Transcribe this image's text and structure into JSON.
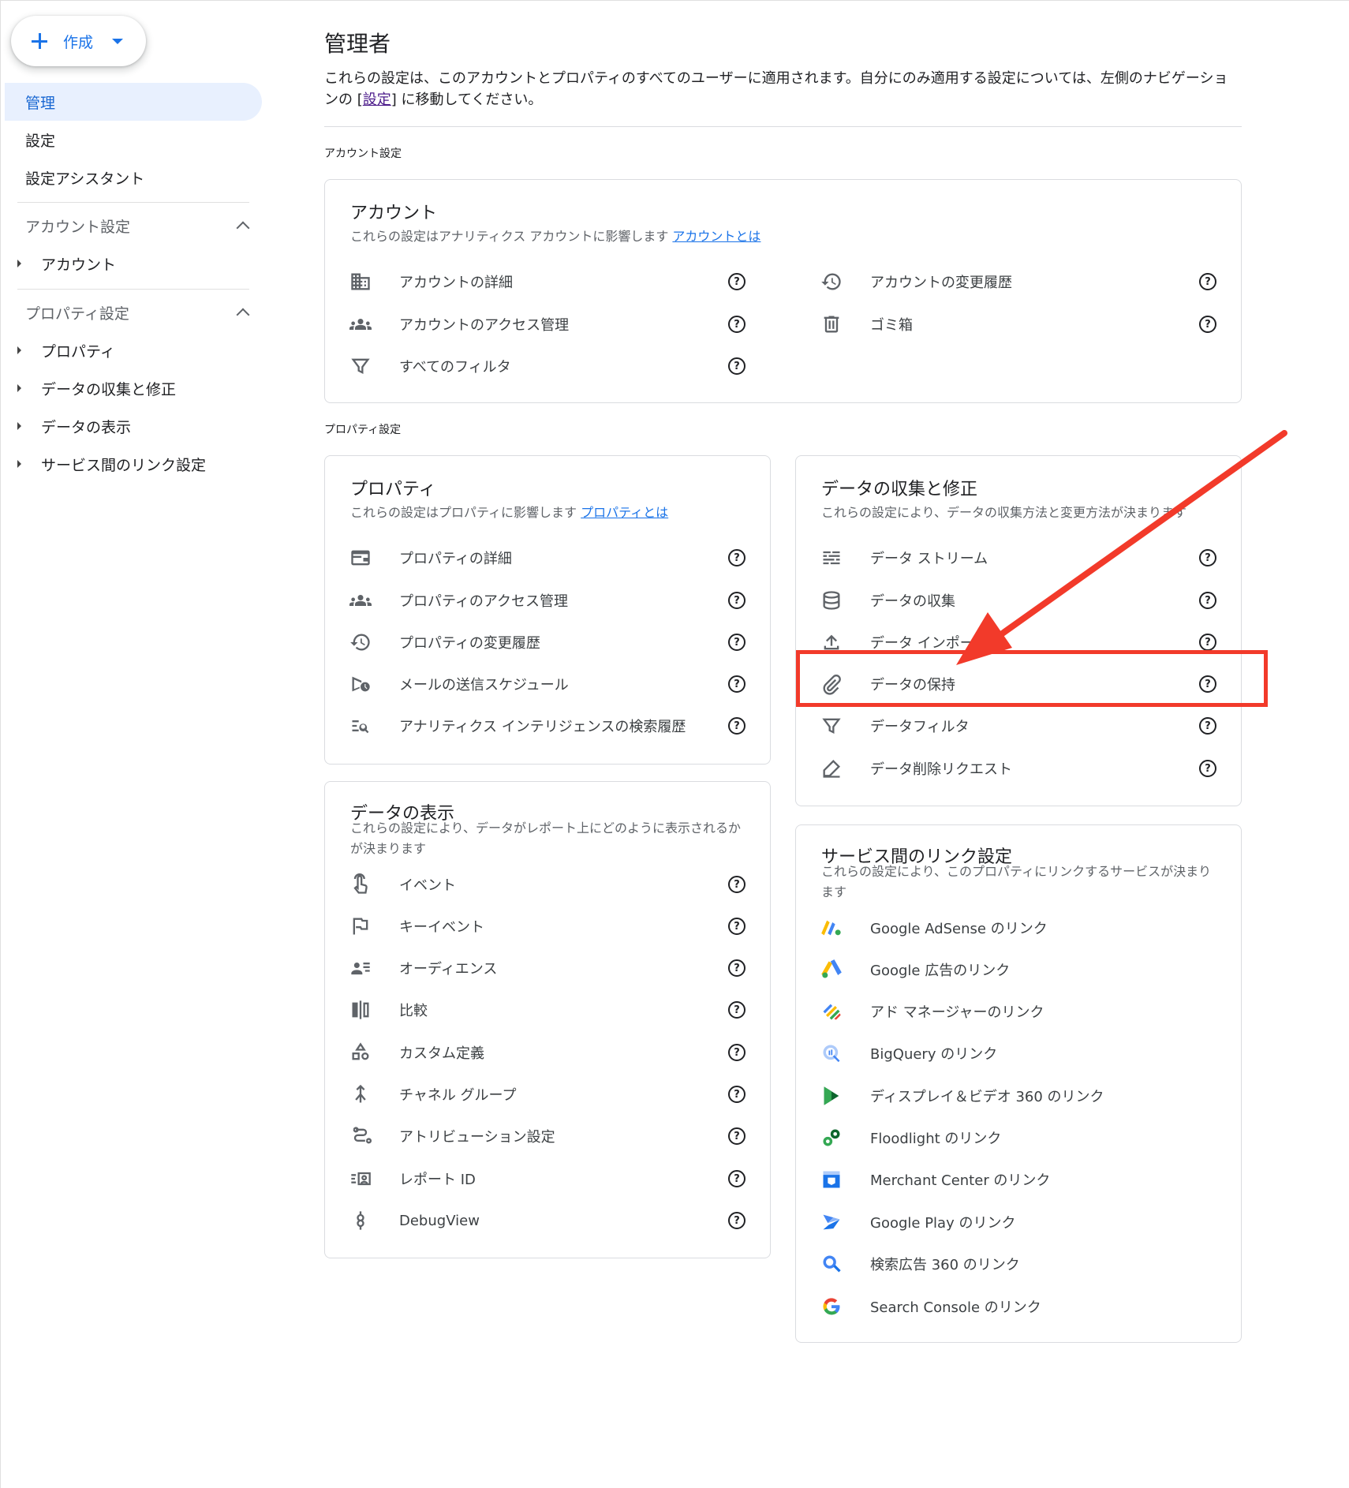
{
  "sidebar": {
    "create_label": "作成",
    "items": [
      {
        "label": "管理"
      },
      {
        "label": "設定"
      },
      {
        "label": "設定アシスタント"
      }
    ],
    "account_section": {
      "label": "アカウント設定",
      "sub": [
        "アカウント"
      ]
    },
    "property_section": {
      "label": "プロパティ設定",
      "sub": [
        "プロパティ",
        "データの収集と修正",
        "データの表示",
        "サービス間のリンク設定"
      ]
    }
  },
  "main": {
    "title": "管理者",
    "desc_before": "これらの設定は、このアカウントとプロパティのすべてのユーザーに適用されます。自分にのみ適用する設定については、左側のナビゲーションの [",
    "desc_link": "設定",
    "desc_after": "] に移動してください。",
    "account_settings_label": "アカウント設定",
    "property_settings_label": "プロパティ設定"
  },
  "account_card": {
    "title": "アカウント",
    "desc": "これらの設定はアナリティクス アカウントに影響します",
    "desc_link": "アカウントとは",
    "rows": [
      {
        "label": "アカウントの詳細",
        "icon": "building-icon"
      },
      {
        "label": "アカウントのアクセス管理",
        "icon": "people-icon"
      },
      {
        "label": "すべてのフィルタ",
        "icon": "filter-icon"
      },
      {
        "label": "アカウントの変更履歴",
        "icon": "history-icon"
      },
      {
        "label": "ゴミ箱",
        "icon": "trash-icon"
      }
    ]
  },
  "property_card": {
    "title": "プロパティ",
    "desc": "これらの設定はプロパティに影響します",
    "desc_link": "プロパティとは",
    "rows": [
      {
        "label": "プロパティの詳細",
        "icon": "window-icon"
      },
      {
        "label": "プロパティのアクセス管理",
        "icon": "people-icon"
      },
      {
        "label": "プロパティの変更履歴",
        "icon": "history-icon"
      },
      {
        "label": "メールの送信スケジュール",
        "icon": "schedule-send-icon"
      },
      {
        "label": "アナリティクス インテリジェンスの検索履歴",
        "icon": "search-list-icon"
      }
    ]
  },
  "collection_card": {
    "title": "データの収集と修正",
    "desc": "これらの設定により、データの収集方法と変更方法が決まります",
    "rows": [
      {
        "label": "データ ストリーム",
        "icon": "stream-icon"
      },
      {
        "label": "データの収集",
        "icon": "database-icon"
      },
      {
        "label": "データ インポート",
        "icon": "upload-icon"
      },
      {
        "label": "データの保持",
        "icon": "attachment-icon"
      },
      {
        "label": "データフィルタ",
        "icon": "filter-icon"
      },
      {
        "label": "データ削除リクエスト",
        "icon": "eraser-icon"
      }
    ]
  },
  "display_card": {
    "title": "データの表示",
    "desc": "これらの設定により、データがレポート上にどのように表示されるかが決まります",
    "rows": [
      {
        "label": "イベント",
        "icon": "touch-icon"
      },
      {
        "label": "キーイベント",
        "icon": "flag-icon"
      },
      {
        "label": "オーディエンス",
        "icon": "audience-icon"
      },
      {
        "label": "比較",
        "icon": "compare-icon"
      },
      {
        "label": "カスタム定義",
        "icon": "shapes-icon"
      },
      {
        "label": "チャネル グループ",
        "icon": "merge-icon"
      },
      {
        "label": "アトリビューション設定",
        "icon": "route-icon"
      },
      {
        "label": "レポート ID",
        "icon": "report-id-icon"
      },
      {
        "label": "DebugView",
        "icon": "debug-icon"
      }
    ]
  },
  "links_card": {
    "title": "サービス間のリンク設定",
    "desc": "これらの設定により、このプロパティにリンクするサービスが決まります",
    "rows": [
      {
        "label": "Google AdSense のリンク",
        "icon": "adsense-icon"
      },
      {
        "label": "Google 広告のリンク",
        "icon": "google-ads-icon"
      },
      {
        "label": "アド マネージャーのリンク",
        "icon": "ad-manager-icon"
      },
      {
        "label": "BigQuery のリンク",
        "icon": "bigquery-icon"
      },
      {
        "label": "ディスプレイ＆ビデオ 360 のリンク",
        "icon": "dv360-icon"
      },
      {
        "label": "Floodlight のリンク",
        "icon": "floodlight-icon"
      },
      {
        "label": "Merchant Center のリンク",
        "icon": "merchant-center-icon"
      },
      {
        "label": "Google Play のリンク",
        "icon": "google-play-icon"
      },
      {
        "label": "検索広告 360 のリンク",
        "icon": "sa360-icon"
      },
      {
        "label": "Search Console のリンク",
        "icon": "search-console-icon"
      }
    ]
  },
  "colors": {
    "accent": "#1a73e8",
    "active_bg": "#e8f0fe",
    "annotation": "#f23a2a"
  }
}
